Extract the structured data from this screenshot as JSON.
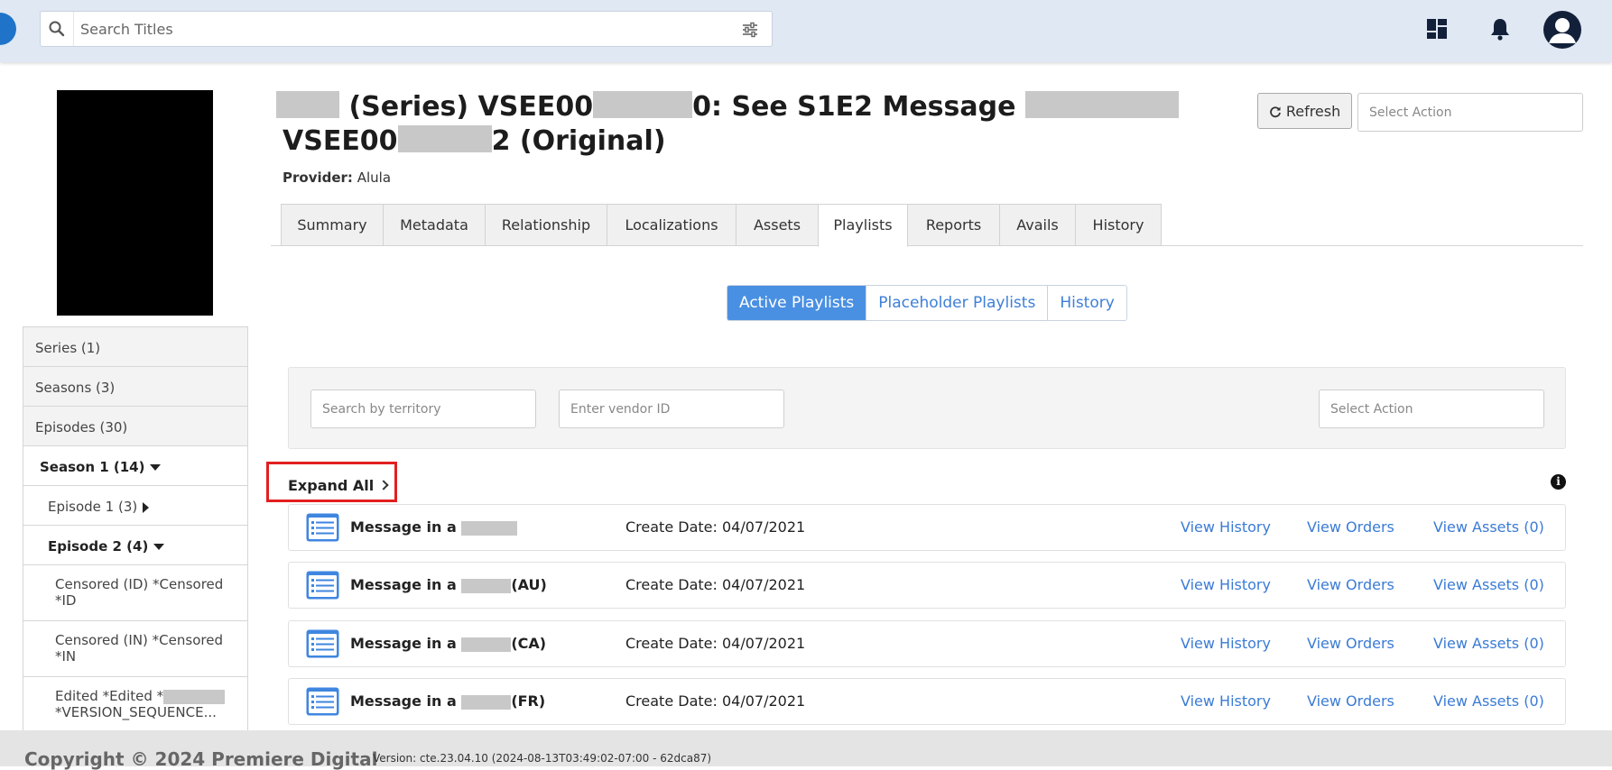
{
  "search": {
    "placeholder": "Search Titles"
  },
  "header": {
    "title_part1": "(Series) VSEE00",
    "title_part2": "0: See S1E2 Message",
    "title_part3": "VSEE00",
    "title_part4": "2 (Original)",
    "provider_label": "Provider:",
    "provider_value": "Alula",
    "refresh_label": "Refresh",
    "select_action_placeholder": "Select Action"
  },
  "tabs": [
    {
      "label": "Summary"
    },
    {
      "label": "Metadata"
    },
    {
      "label": "Relationship"
    },
    {
      "label": "Localizations"
    },
    {
      "label": "Assets"
    },
    {
      "label": "Playlists",
      "active": true
    },
    {
      "label": "Reports"
    },
    {
      "label": "Avails"
    },
    {
      "label": "History"
    }
  ],
  "playlist_toggle": [
    {
      "label": "Active Playlists",
      "active": true
    },
    {
      "label": "Placeholder Playlists"
    },
    {
      "label": "History"
    }
  ],
  "filters": {
    "territory_placeholder": "Search by territory",
    "vendor_placeholder": "Enter vendor ID",
    "select_action_placeholder": "Select Action"
  },
  "expand_all_label": "Expand All",
  "sidebar": {
    "items": [
      {
        "label": "Series (1)"
      },
      {
        "label": "Seasons (3)"
      },
      {
        "label": "Episodes (30)"
      },
      {
        "label": "Season 1 (14)"
      },
      {
        "label": "Episode 1 (3)"
      },
      {
        "label": "Episode 2 (4)"
      },
      {
        "label": "Censored (ID) *Censored *ID"
      },
      {
        "label": "Censored (IN) *Censored *IN"
      },
      {
        "label_a": "Edited *Edited *",
        "label_b": "*VERSION_SEQUENCE..."
      }
    ]
  },
  "playlists": [
    {
      "name_prefix": "Message in a",
      "name_suffix": "",
      "create_date": "Create Date: 04/07/2021"
    },
    {
      "name_prefix": "Message in a",
      "name_suffix": "(AU)",
      "create_date": "Create Date: 04/07/2021"
    },
    {
      "name_prefix": "Message in a",
      "name_suffix": "(CA)",
      "create_date": "Create Date: 04/07/2021"
    },
    {
      "name_prefix": "Message in a",
      "name_suffix": "(FR)",
      "create_date": "Create Date: 04/07/2021"
    }
  ],
  "row_links": {
    "view_history": "View History",
    "view_orders": "View Orders",
    "view_assets": "View Assets (0)"
  },
  "footer": {
    "copyright": "Copyright © 2024 Premiere Digital",
    "version": "Version: cte.23.04.10 (2024-08-13T03:49:02-07:00 - 62dca87)"
  },
  "colors": {
    "accent": "#4a90e2",
    "link": "#3a7bd5",
    "highlight_box": "#e1201f"
  }
}
